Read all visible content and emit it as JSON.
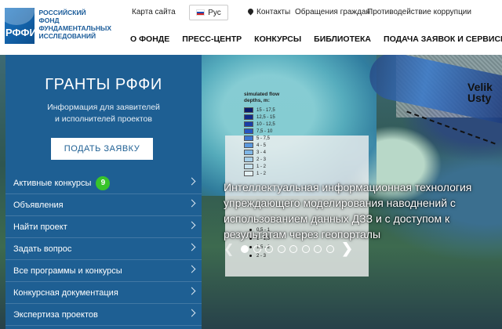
{
  "logo": {
    "abbr": "РФФИ",
    "lines": [
      "РОССИЙСКИЙ",
      "ФОНД",
      "ФУНДАМЕНТАЛЬНЫХ",
      "ИССЛЕДОВАНИЙ"
    ]
  },
  "topbar": {
    "sitemap": "Карта сайта",
    "language": "Рус",
    "contacts": "Контакты",
    "appeals": "Обращения граждан",
    "anticorruption": "Противодействие коррупции"
  },
  "nav": {
    "items": [
      "О ФОНДЕ",
      "ПРЕСС-ЦЕНТР",
      "КОНКУРСЫ",
      "БИБЛИОТЕКА",
      "ПОДАЧА ЗАЯВОК И СЕРВИСЫ"
    ]
  },
  "sidebar": {
    "title": "ГРАНТЫ РФФИ",
    "subtitle_line1": "Информация для заявителей",
    "subtitle_line2": "и исполнителей проектов",
    "apply_button": "ПОДАТЬ ЗАЯВКУ",
    "menu": [
      {
        "label": "Активные конкурсы",
        "badge": "9"
      },
      {
        "label": "Объявления"
      },
      {
        "label": "Найти проект"
      },
      {
        "label": "Задать вопрос"
      },
      {
        "label": "Все программы и конкурсы"
      },
      {
        "label": "Конкурсная документация"
      },
      {
        "label": "Экспертиза проектов"
      }
    ]
  },
  "hero": {
    "map_label_line1": "Velik",
    "map_label_line2": "Usty",
    "legend_title_line1": "simulated flow",
    "legend_title_line2": "depths, m:",
    "legend_entries": [
      {
        "label": "15 - 17,5",
        "color": "#0a1a6b"
      },
      {
        "label": "12,5 - 15",
        "color": "#0f2a8a"
      },
      {
        "label": "10 - 12,5",
        "color": "#1a3ea8"
      },
      {
        "label": "7,5 - 10",
        "color": "#2656c0"
      },
      {
        "label": "5 - 7,5",
        "color": "#3c77d2"
      },
      {
        "label": "4 - 5",
        "color": "#5a98de"
      },
      {
        "label": "3 - 4",
        "color": "#7fb6e6"
      },
      {
        "label": "2 - 3",
        "color": "#a7cfe9"
      },
      {
        "label": "1 - 2",
        "color": "#c8e3ef"
      },
      {
        "label": "1 - 2",
        "color": "#e3f1f4"
      }
    ],
    "legend_sub": [
      "0,5 - 1",
      "1 - 1,5",
      "1,5 - 2",
      "2 - 3"
    ],
    "caption": "Интеллектуальная информационная технология упреждающего моделирования наводнений с использованием данных ДЗЗ и с доступом к результатам через геопорталы",
    "slides_total": 8,
    "active_slide": 1
  },
  "colors": {
    "sidebar_bg": "#1e5f93",
    "badge": "#38c42a",
    "brand": "#1b5c9a"
  }
}
